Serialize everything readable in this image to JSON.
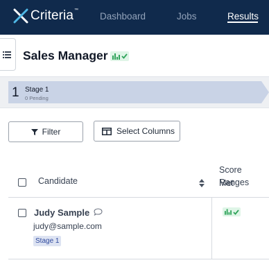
{
  "header": {
    "logo_text": "Criteria",
    "logo_tm": "™",
    "nav": [
      {
        "label": "Dashboard",
        "active": false
      },
      {
        "label": "Jobs",
        "active": false
      },
      {
        "label": "Results",
        "active": true
      }
    ]
  },
  "page": {
    "title": "Sales Manager"
  },
  "stage": {
    "number": "1",
    "name": "Stage 1",
    "pending": "0 Pending"
  },
  "toolbar": {
    "filter_label": "Filter",
    "columns_label": "Select Columns"
  },
  "table": {
    "columns": {
      "candidate": "Candidate",
      "score_line1": "Score Ranges",
      "score_line2": "Met"
    },
    "rows": [
      {
        "name": "Judy Sample",
        "email": "judy@sample.com",
        "stage": "Stage 1"
      }
    ]
  },
  "colors": {
    "nav_bg": "#102a4c",
    "stage_arrow": "#c9d3e6",
    "score_green": "#2fa35a",
    "score_bg": "#dff5e7",
    "badge_bg": "#dde3f2",
    "badge_text": "#2f4a9e"
  },
  "icons": [
    "criteria-logo-icon",
    "hamburger-icon",
    "score-bar-chart-icon",
    "check-icon",
    "filter-funnel-icon",
    "columns-icon",
    "sort-icon",
    "comment-icon"
  ]
}
